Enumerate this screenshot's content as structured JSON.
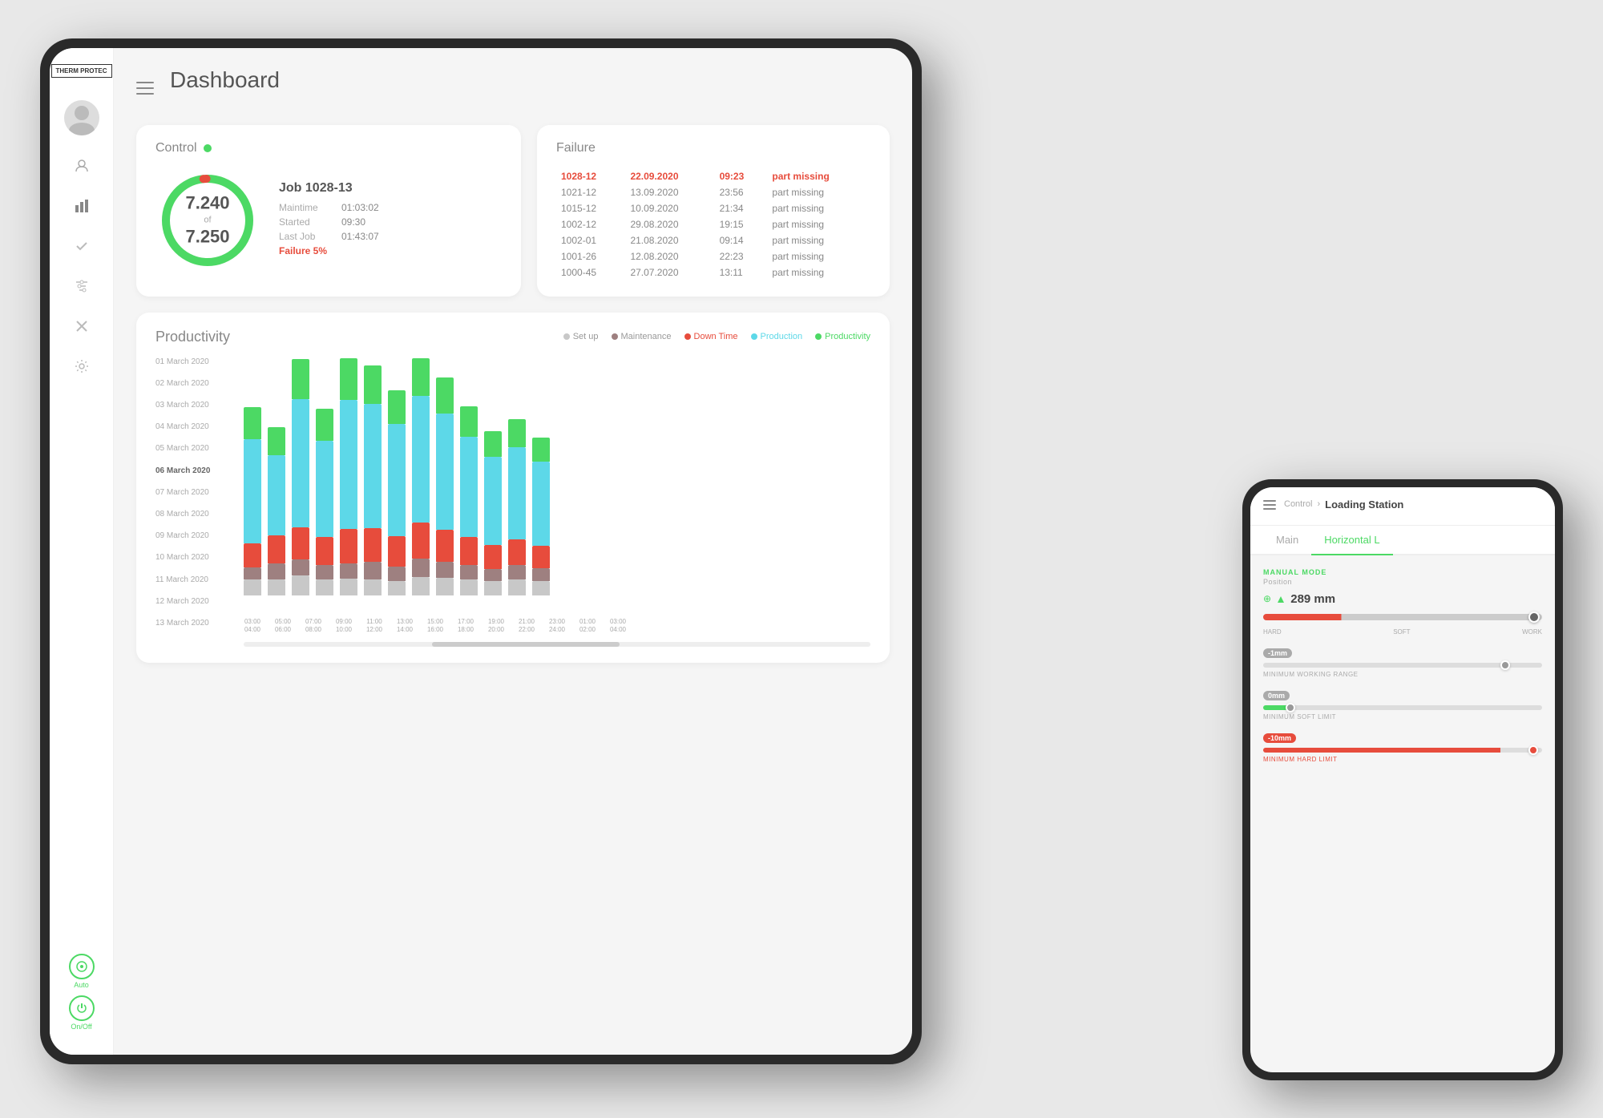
{
  "page": {
    "title": "Dashboard"
  },
  "sidebar": {
    "logo": "THERM\nPROTEC",
    "icons": [
      {
        "name": "user-icon",
        "symbol": "👤",
        "active": false
      },
      {
        "name": "chart-icon",
        "symbol": "▮▮",
        "active": true
      },
      {
        "name": "check-icon",
        "symbol": "✓",
        "active": false
      },
      {
        "name": "filter-icon",
        "symbol": "⚙",
        "active": false
      },
      {
        "name": "close-icon",
        "symbol": "✕",
        "active": false
      },
      {
        "name": "settings-icon",
        "symbol": "⚙",
        "active": false
      }
    ],
    "auto_label": "Auto",
    "onoff_label": "On/Off"
  },
  "control_panel": {
    "title": "Control",
    "donut": {
      "value": "7.240",
      "of": "of",
      "total": "7.250",
      "percentage": 99.86
    },
    "job": {
      "title": "Job 1028-13",
      "maintime_label": "Maintime",
      "maintime_value": "01:03:02",
      "started_label": "Started",
      "started_value": "09:30",
      "lastjob_label": "Last Job",
      "lastjob_value": "01:43:07",
      "failure_label": "Failure 5%"
    }
  },
  "failure_panel": {
    "title": "Failure",
    "rows": [
      {
        "id": "1028-12",
        "date": "22.09.2020",
        "time": "09:23",
        "type": "part missing",
        "highlight": true
      },
      {
        "id": "1021-12",
        "date": "13.09.2020",
        "time": "23:56",
        "type": "part missing",
        "highlight": false
      },
      {
        "id": "1015-12",
        "date": "10.09.2020",
        "time": "21:34",
        "type": "part missing",
        "highlight": false
      },
      {
        "id": "1002-12",
        "date": "29.08.2020",
        "time": "19:15",
        "type": "part missing",
        "highlight": false
      },
      {
        "id": "1002-01",
        "date": "21.08.2020",
        "time": "09:14",
        "type": "part missing",
        "highlight": false
      },
      {
        "id": "1001-26",
        "date": "12.08.2020",
        "time": "22:23",
        "type": "part missing",
        "highlight": false
      },
      {
        "id": "1000-45",
        "date": "27.07.2020",
        "time": "13:11",
        "type": "part missing",
        "highlight": false
      }
    ]
  },
  "productivity": {
    "title": "Productivity",
    "legend": [
      {
        "label": "Set up",
        "color": "#c8c8c8"
      },
      {
        "label": "Maintenance",
        "color": "#9e8080"
      },
      {
        "label": "Down Time",
        "color": "#e74c3c"
      },
      {
        "label": "Production",
        "color": "#5dd8e8"
      },
      {
        "label": "Productivity",
        "color": "#4cd964"
      }
    ],
    "dates": [
      {
        "label": "01 March 2020",
        "bold": false
      },
      {
        "label": "02 March 2020",
        "bold": false
      },
      {
        "label": "03 March 2020",
        "bold": false
      },
      {
        "label": "04 March 2020",
        "bold": false
      },
      {
        "label": "05 March 2020",
        "bold": false
      },
      {
        "label": "06 March 2020",
        "bold": true
      },
      {
        "label": "07 March 2020",
        "bold": false
      },
      {
        "label": "08 March 2020",
        "bold": false
      },
      {
        "label": "09 March 2020",
        "bold": false
      },
      {
        "label": "10 March 2020",
        "bold": false
      },
      {
        "label": "11 March 2020",
        "bold": false
      },
      {
        "label": "12 March 2020",
        "bold": false
      },
      {
        "label": "13 March 2020",
        "bold": false
      }
    ],
    "time_labels": [
      "03:00\n04:00",
      "05:00\n06:00",
      "07:00\n08:00",
      "09:00\n10:00",
      "11:00\n12:00",
      "13:00\n14:00",
      "15:00\n16:00",
      "17:00\n18:00",
      "19:00\n20:00",
      "21:00\n22:00",
      "23:00\n24:00",
      "01:00\n02:00",
      "03:00\n04:00"
    ],
    "bars": [
      {
        "setup": 20,
        "maintenance": 15,
        "downtime": 30,
        "production": 130,
        "productivity": 40
      },
      {
        "setup": 20,
        "maintenance": 20,
        "downtime": 35,
        "production": 100,
        "productivity": 35
      },
      {
        "setup": 25,
        "maintenance": 20,
        "downtime": 40,
        "production": 160,
        "productivity": 50
      },
      {
        "setup": 20,
        "maintenance": 18,
        "downtime": 35,
        "production": 120,
        "productivity": 40
      },
      {
        "setup": 22,
        "maintenance": 20,
        "downtime": 45,
        "production": 170,
        "productivity": 55
      },
      {
        "setup": 20,
        "maintenance": 22,
        "downtime": 42,
        "production": 155,
        "productivity": 48
      },
      {
        "setup": 18,
        "maintenance": 18,
        "downtime": 38,
        "production": 140,
        "productivity": 42
      },
      {
        "setup": 25,
        "maintenance": 25,
        "downtime": 50,
        "production": 175,
        "productivity": 52
      },
      {
        "setup": 22,
        "maintenance": 20,
        "downtime": 40,
        "production": 145,
        "productivity": 45
      },
      {
        "setup": 20,
        "maintenance": 18,
        "downtime": 35,
        "production": 125,
        "productivity": 38
      },
      {
        "setup": 18,
        "maintenance": 15,
        "downtime": 30,
        "production": 110,
        "productivity": 32
      },
      {
        "setup": 20,
        "maintenance": 18,
        "downtime": 32,
        "production": 115,
        "productivity": 35
      },
      {
        "setup": 18,
        "maintenance": 16,
        "downtime": 28,
        "production": 105,
        "productivity": 30
      }
    ]
  },
  "phone": {
    "breadcrumb": "Control > Loading Station",
    "title": "Loading Station",
    "tabs": [
      "Main",
      "Horizontal L"
    ],
    "active_tab": 1,
    "mode": "MANUAL MODE",
    "position_label": "Position",
    "position_value": "289 mm",
    "slider1": {
      "label": "MINIMUM WORKING RANGE",
      "value": "-1mm"
    },
    "slider2": {
      "label": "MINIMUM SOFT LIMIT",
      "value": "0mm"
    },
    "slider3": {
      "label": "MINIMUM HARD LIMIT",
      "value": "-10mm"
    }
  },
  "colors": {
    "green": "#4cd964",
    "red": "#e74c3c",
    "cyan": "#5dd8e8",
    "gray": "#c8c8c8",
    "brown": "#9e8080"
  }
}
